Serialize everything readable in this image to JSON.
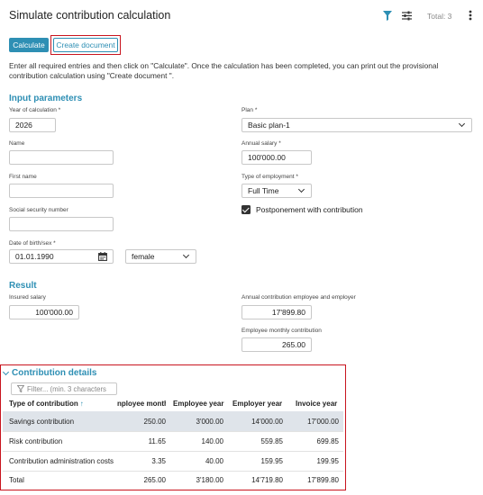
{
  "header": {
    "title": "Simulate contribution calculation",
    "total_label": "Total: 3",
    "filter_icon": "filter-icon",
    "settings_icon": "sliders-icon",
    "menu_icon": "kebab-menu-icon"
  },
  "toolbar": {
    "calculate_label": "Calculate",
    "create_document_label": "Create document"
  },
  "instructions": "Enter all required entries and then click on \"Calculate\". Once the calculation has been completed, you can print out the provisional contribution calculation using \"Create document \".",
  "input_parameters": {
    "title": "Input parameters",
    "year_label": "Year of calculation *",
    "year_value": "2026",
    "name_label": "Name",
    "name_value": "",
    "first_name_label": "First name",
    "first_name_value": "",
    "ssn_label": "Social security number",
    "ssn_value": "",
    "dob_label": "Date of birth/sex *",
    "dob_value": "01.01.1990",
    "sex_value": "female",
    "plan_label": "Plan *",
    "plan_value": "Basic plan-1",
    "salary_label": "Annual salary *",
    "salary_value": "100'000.00",
    "employment_label": "Type of employment *",
    "employment_value": "Full Time",
    "postponement_label": "Postponement with contribution",
    "postponement_checked": true
  },
  "result": {
    "title": "Result",
    "insured_salary_label": "Insured salary",
    "insured_salary_value": "100'000.00",
    "annual_contribution_label": "Annual contribution employee and employer",
    "annual_contribution_value": "17'899.80",
    "monthly_contribution_label": "Employee monthly contribution",
    "monthly_contribution_value": "265.00"
  },
  "contribution_details": {
    "title": "Contribution details",
    "filter_placeholder": "Filter... (min. 3 characters",
    "columns": [
      "Type of contribution",
      "nployee month",
      "Employee year",
      "Employer year",
      "Invoice year"
    ],
    "sort_arrow": "↑",
    "rows": [
      [
        "Savings contribution",
        "250.00",
        "3'000.00",
        "14'000.00",
        "17'000.00"
      ],
      [
        "Risk contribution",
        "11.65",
        "140.00",
        "559.85",
        "699.85"
      ],
      [
        "Contribution administration costs",
        "3.35",
        "40.00",
        "159.95",
        "199.95"
      ],
      [
        "Total",
        "265.00",
        "3'180.00",
        "14'719.80",
        "17'899.80"
      ]
    ]
  },
  "colors": {
    "accent": "#2e8fb4",
    "highlight": "#c8141e",
    "selected_row": "#dfe4ea"
  }
}
